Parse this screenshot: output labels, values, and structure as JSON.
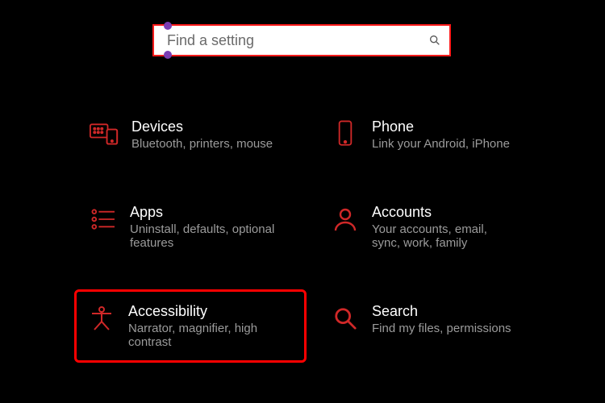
{
  "colors": {
    "accent": "#ff1a1a",
    "icon": "#d02828",
    "highlight_border": "#ff0000",
    "text_primary": "#ffffff",
    "text_secondary": "#9b9b9b"
  },
  "search": {
    "placeholder": "Find a setting",
    "value": ""
  },
  "tiles": [
    {
      "id": "devices",
      "icon": "devices-icon",
      "title": "Devices",
      "subtitle": "Bluetooth, printers, mouse",
      "highlighted": false
    },
    {
      "id": "phone",
      "icon": "phone-icon",
      "title": "Phone",
      "subtitle": "Link your Android, iPhone",
      "highlighted": false
    },
    {
      "id": "apps",
      "icon": "apps-icon",
      "title": "Apps",
      "subtitle": "Uninstall, defaults, optional features",
      "highlighted": false
    },
    {
      "id": "accounts",
      "icon": "accounts-icon",
      "title": "Accounts",
      "subtitle": "Your accounts, email, sync, work, family",
      "highlighted": false
    },
    {
      "id": "accessibility",
      "icon": "accessibility-icon",
      "title": "Accessibility",
      "subtitle": "Narrator, magnifier, high contrast",
      "highlighted": true
    },
    {
      "id": "search",
      "icon": "search-icon",
      "title": "Search",
      "subtitle": "Find my files, permissions",
      "highlighted": false
    }
  ]
}
